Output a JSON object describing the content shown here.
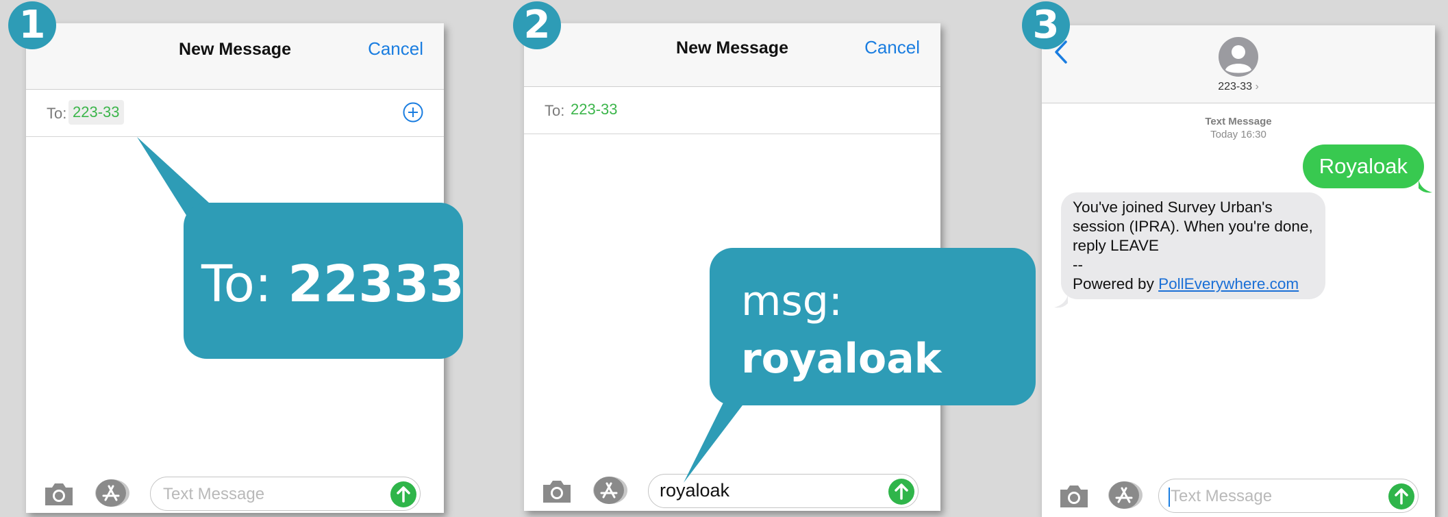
{
  "step_badges": [
    "1",
    "2",
    "3"
  ],
  "colors": {
    "badge_and_callout": "#2e9cb6",
    "link_blue": "#1a7de0",
    "recipient_green": "#3bb54a",
    "imessage_green": "#38c950",
    "received_bubble": "#e9e9eb",
    "page_background": "#d9d9d9"
  },
  "screen1": {
    "title": "New Message",
    "cancel": "Cancel",
    "to_label": "To:",
    "recipient": "223-33",
    "add_icon": "plus-circle-icon",
    "placeholder": "Text Message",
    "callout": {
      "prefix": "To:",
      "value": "22333"
    }
  },
  "screen2": {
    "title": "New Message",
    "cancel": "Cancel",
    "to_label": "To:",
    "recipient": "223-33",
    "message_text": "royaloak",
    "callout": {
      "prefix": "msg:",
      "value": "royaloak"
    }
  },
  "screen3": {
    "contact": "223-33",
    "chevron": "›",
    "conversation_type": "Text Message",
    "timestamp": "Today 16:30",
    "sent_message": "Royaloak",
    "reply_lines": [
      "You've joined Survey Urban's",
      "session (IPRA). When you're done,",
      "reply LEAVE",
      "--"
    ],
    "reply_powered_by": "Powered by",
    "reply_link": "PollEverywhere.com",
    "placeholder": "Text Message"
  },
  "toolbar_icons": [
    "camera-icon",
    "app-store-icon",
    "send-arrow-icon"
  ]
}
